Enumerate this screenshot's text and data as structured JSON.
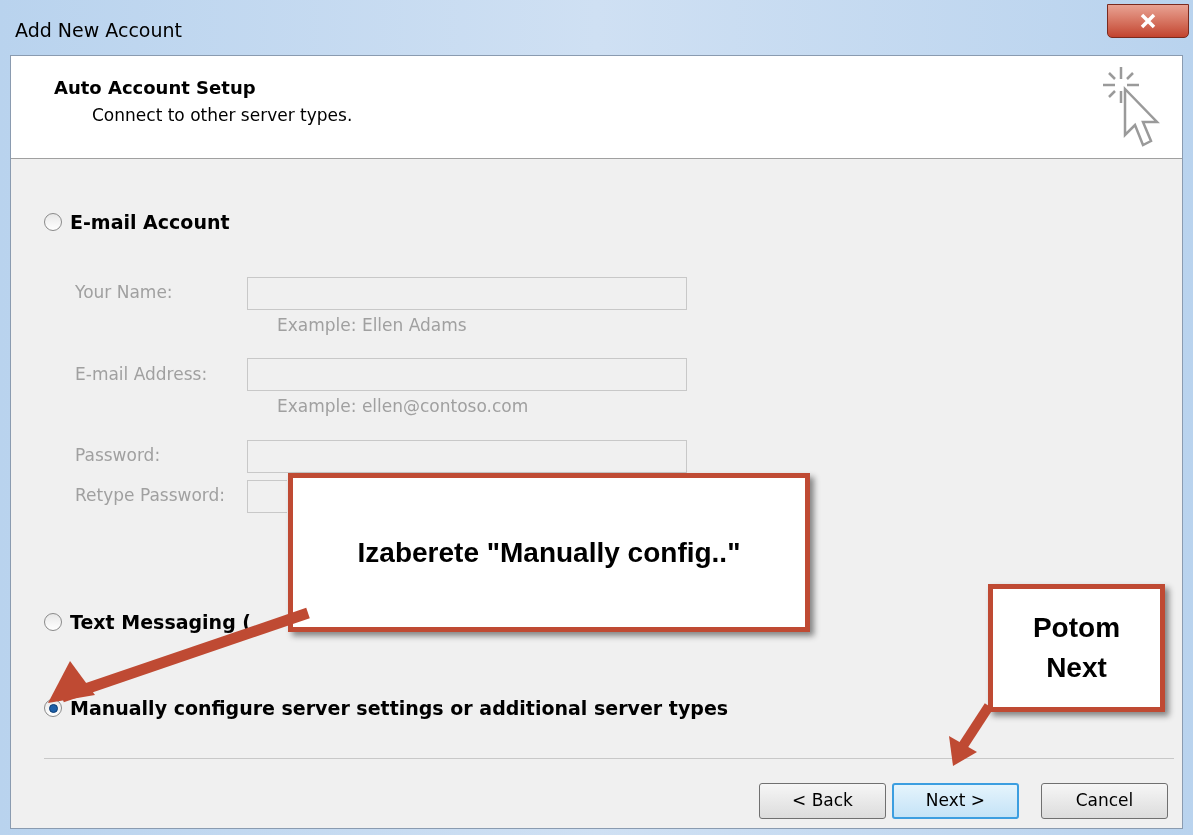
{
  "window": {
    "title": "Add New Account"
  },
  "header": {
    "title": "Auto Account Setup",
    "subtitle": "Connect to other server types."
  },
  "options": [
    {
      "label": "E-mail Account",
      "selected": false
    },
    {
      "label": "Text Messaging (",
      "selected": false
    },
    {
      "label": "Manually configure server settings or additional server types",
      "selected": true
    }
  ],
  "fields": [
    {
      "label": "Your Name:",
      "example": "Example: Ellen Adams",
      "disabled": true
    },
    {
      "label": "E-mail Address:",
      "example": "Example: ellen@contoso.com",
      "disabled": true
    },
    {
      "label": "Password:",
      "disabled": true
    },
    {
      "label": "Retype Password:",
      "disabled": true
    }
  ],
  "buttons": [
    {
      "label": "< Back",
      "default": false
    },
    {
      "label": "Next >",
      "default": true
    },
    {
      "label": "Cancel",
      "default": false
    }
  ],
  "callouts": [
    {
      "text": "Izaberete \"Manually config..\""
    },
    {
      "text": "Potom Next"
    }
  ]
}
